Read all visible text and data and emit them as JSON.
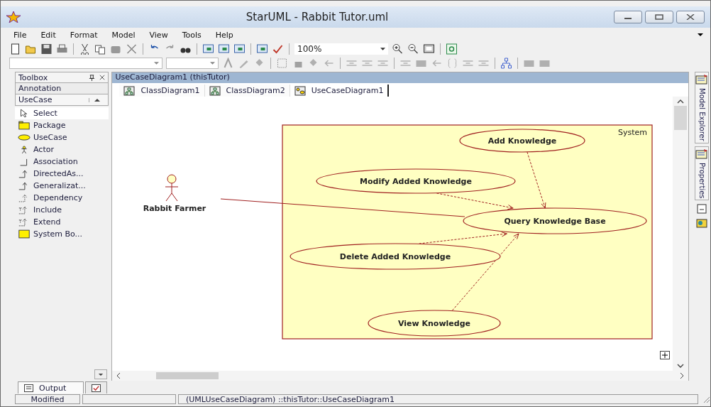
{
  "window": {
    "title": "StarUML - Rabbit Tutor.uml"
  },
  "menu": [
    "File",
    "Edit",
    "Format",
    "Model",
    "View",
    "Tools",
    "Help"
  ],
  "zoom": {
    "value": "100%"
  },
  "toolbox": {
    "title": "Toolbox",
    "groups": [
      {
        "label": "Annotation",
        "expanded": false
      },
      {
        "label": "UseCase",
        "expanded": true
      }
    ],
    "items": [
      {
        "kind": "select",
        "label": "Select",
        "selected": true
      },
      {
        "kind": "package",
        "label": "Package",
        "selected": false
      },
      {
        "kind": "usecase",
        "label": "UseCase",
        "selected": false
      },
      {
        "kind": "actor",
        "label": "Actor",
        "selected": false
      },
      {
        "kind": "association",
        "label": "Association",
        "selected": false
      },
      {
        "kind": "directed",
        "label": "DirectedAs...",
        "selected": false
      },
      {
        "kind": "generalization",
        "label": "Generalizat...",
        "selected": false
      },
      {
        "kind": "dependency",
        "label": "Dependency",
        "selected": false
      },
      {
        "kind": "include",
        "label": "Include",
        "selected": false
      },
      {
        "kind": "extend",
        "label": "Extend",
        "selected": false
      },
      {
        "kind": "systembox",
        "label": "System Bo...",
        "selected": false
      }
    ]
  },
  "document": {
    "title": "UseCaseDiagram1 (thisTutor)"
  },
  "diagram_tabs": [
    {
      "kind": "class",
      "label": "ClassDiagram1",
      "selected": false
    },
    {
      "kind": "class",
      "label": "ClassDiagram2",
      "selected": false
    },
    {
      "kind": "usecase",
      "label": "UseCaseDiagram1",
      "selected": true
    }
  ],
  "diagram": {
    "system": "System",
    "actors": [
      "Rabbit Farmer"
    ],
    "use_cases": [
      "Add Knowledge",
      "Modify Added Knowledge",
      "Query Knowledge Base",
      "Delete Added Knowledge",
      "View Knowledge"
    ]
  },
  "side_tabs": [
    "Model Explorer",
    "Properties"
  ],
  "bottom_tabs": [
    {
      "kind": "output",
      "label": "Output",
      "selected": true
    },
    {
      "kind": "tasks",
      "selected": false
    }
  ],
  "status_bar": {
    "state": "Modified",
    "path": "(UMLUseCaseDiagram) ::thisTutor::UseCaseDiagram1"
  }
}
